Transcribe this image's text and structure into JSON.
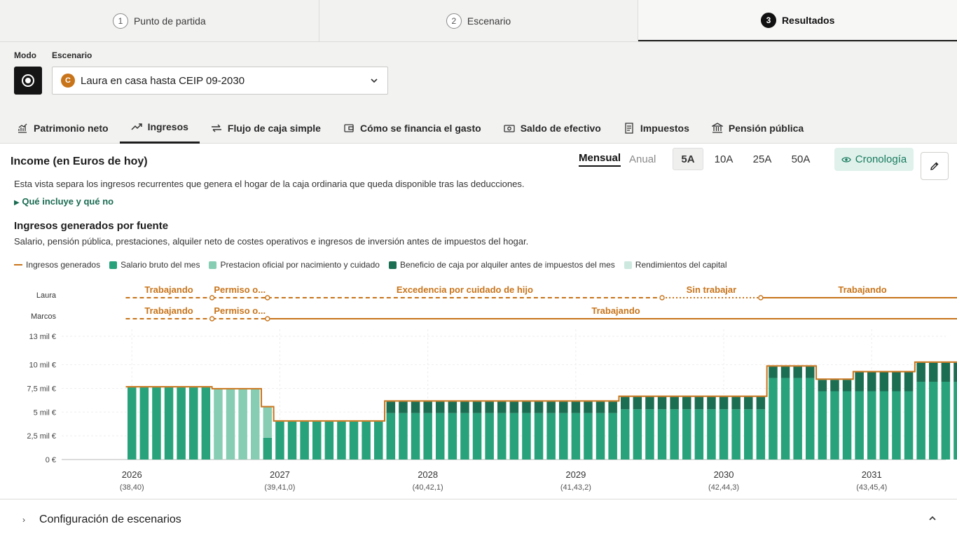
{
  "stepper": [
    {
      "num": "1",
      "label": "Punto de partida"
    },
    {
      "num": "2",
      "label": "Escenario"
    },
    {
      "num": "3",
      "label": "Resultados"
    }
  ],
  "scenario": {
    "mode_label": "Modo",
    "scenario_label": "Escenario",
    "badge": "C",
    "selected": "Laura en casa hasta CEIP 09-2030"
  },
  "tabs": [
    {
      "label": "Patrimonio neto",
      "icon": "chart-icon"
    },
    {
      "label": "Ingresos",
      "icon": "trend-up-icon"
    },
    {
      "label": "Flujo de caja simple",
      "icon": "swap-icon"
    },
    {
      "label": "Cómo se financia el gasto",
      "icon": "wallet-icon"
    },
    {
      "label": "Saldo de efectivo",
      "icon": "cash-icon"
    },
    {
      "label": "Impuestos",
      "icon": "receipt-icon"
    },
    {
      "label": "Pensión pública",
      "icon": "bank-icon"
    }
  ],
  "content": {
    "title": "Income (en Euros de hoy)",
    "mensual": "Mensual",
    "anual": "Anual",
    "ranges": [
      "5A",
      "10A",
      "25A",
      "50A"
    ],
    "cronologia": "Cronología",
    "desc": "Esta vista separa los ingresos recurrentes que genera el hogar de la caja ordinaria que queda disponible tras las deducciones.",
    "details": "Qué incluye y qué no",
    "h2": "Ingresos generados por fuente",
    "sub": "Salario, pensión pública, prestaciones, alquiler neto de costes operativos e ingresos de inversión antes de impuestos del hogar."
  },
  "colors": {
    "salario": "#27a27b",
    "prestacion": "#87cdb3",
    "alquiler": "#1b6e52",
    "rendimientos": "#cde9df",
    "ingresos_line": "#c8741a"
  },
  "chart_data": {
    "type": "bar",
    "stacked": true,
    "legend": [
      {
        "name": "Ingresos generados",
        "kind": "line"
      },
      {
        "name": "Salario bruto del mes",
        "kind": "salario"
      },
      {
        "name": "Prestacion oficial por nacimiento y cuidado",
        "kind": "prestacion"
      },
      {
        "name": "Beneficio de caja por alquiler antes de impuestos del mes",
        "kind": "alquiler"
      },
      {
        "name": "Rendimientos del capital",
        "kind": "rendimientos"
      }
    ],
    "y_ticks": [
      {
        "v": 0,
        "label": "0 €"
      },
      {
        "v": 2500,
        "label": "2,5 mil €"
      },
      {
        "v": 5000,
        "label": "5 mil €"
      },
      {
        "v": 7500,
        "label": "7,5 mil €"
      },
      {
        "v": 10000,
        "label": "10 mil €"
      },
      {
        "v": 13000,
        "label": "13 mil €"
      }
    ],
    "ylim": [
      0,
      13000
    ],
    "x_ticks": [
      {
        "month": 0,
        "year": "2026",
        "ages": "(38,40)"
      },
      {
        "month": 12,
        "year": "2027",
        "ages": "(39,41,0)"
      },
      {
        "month": 24,
        "year": "2028",
        "ages": "(40,42,1)"
      },
      {
        "month": 36,
        "year": "2029",
        "ages": "(41,43,2)"
      },
      {
        "month": 48,
        "year": "2030",
        "ages": "(42,44,3)"
      },
      {
        "month": 60,
        "year": "2031",
        "ages": "(43,45,4)"
      }
    ],
    "timeline": [
      {
        "person": "Laura",
        "segments": [
          {
            "label": "Trabajando",
            "start": -0.5,
            "end": 6.5,
            "style": "dashed"
          },
          {
            "label": "Permiso o...",
            "start": 6.5,
            "end": 11,
            "style": "dashed"
          },
          {
            "label": "Excedencia por cuidado de hijo",
            "start": 11,
            "end": 43,
            "style": "dashed"
          },
          {
            "label": "Sin trabajar",
            "start": 43,
            "end": 51,
            "style": "dotted"
          },
          {
            "label": "Trabajando",
            "start": 51,
            "end": 67.5,
            "style": "solid"
          }
        ]
      },
      {
        "person": "Marcos",
        "segments": [
          {
            "label": "Trabajando",
            "start": -0.5,
            "end": 6.5,
            "style": "dashed"
          },
          {
            "label": "Permiso o...",
            "start": 6.5,
            "end": 11,
            "style": "dashed"
          },
          {
            "label": "Trabajando",
            "start": 11,
            "end": 67.5,
            "style": "solid"
          }
        ]
      }
    ],
    "months": [
      {
        "s": 7600,
        "p": 0,
        "a": 0
      },
      {
        "s": 7600,
        "p": 0,
        "a": 0
      },
      {
        "s": 7600,
        "p": 0,
        "a": 0
      },
      {
        "s": 7600,
        "p": 0,
        "a": 0
      },
      {
        "s": 7600,
        "p": 0,
        "a": 0
      },
      {
        "s": 7600,
        "p": 0,
        "a": 0
      },
      {
        "s": 7600,
        "p": 0,
        "a": 0
      },
      {
        "s": 0,
        "p": 7400,
        "a": 0
      },
      {
        "s": 0,
        "p": 7400,
        "a": 0
      },
      {
        "s": 0,
        "p": 7400,
        "a": 0
      },
      {
        "s": 0,
        "p": 7400,
        "a": 0
      },
      {
        "s": 2300,
        "p": 3200,
        "a": 0
      },
      {
        "s": 4000,
        "p": 0,
        "a": 0
      },
      {
        "s": 4000,
        "p": 0,
        "a": 0
      },
      {
        "s": 4000,
        "p": 0,
        "a": 0
      },
      {
        "s": 4000,
        "p": 0,
        "a": 0
      },
      {
        "s": 4000,
        "p": 0,
        "a": 0
      },
      {
        "s": 4000,
        "p": 0,
        "a": 0
      },
      {
        "s": 4000,
        "p": 0,
        "a": 0
      },
      {
        "s": 4000,
        "p": 0,
        "a": 0
      },
      {
        "s": 4000,
        "p": 0,
        "a": 0
      },
      {
        "s": 4900,
        "p": 0,
        "a": 1200
      },
      {
        "s": 4900,
        "p": 0,
        "a": 1200
      },
      {
        "s": 4900,
        "p": 0,
        "a": 1200
      },
      {
        "s": 4900,
        "p": 0,
        "a": 1200
      },
      {
        "s": 4900,
        "p": 0,
        "a": 1200
      },
      {
        "s": 4900,
        "p": 0,
        "a": 1200
      },
      {
        "s": 4900,
        "p": 0,
        "a": 1200
      },
      {
        "s": 4900,
        "p": 0,
        "a": 1200
      },
      {
        "s": 4900,
        "p": 0,
        "a": 1200
      },
      {
        "s": 4900,
        "p": 0,
        "a": 1200
      },
      {
        "s": 4900,
        "p": 0,
        "a": 1200
      },
      {
        "s": 4900,
        "p": 0,
        "a": 1200
      },
      {
        "s": 4900,
        "p": 0,
        "a": 1200
      },
      {
        "s": 4900,
        "p": 0,
        "a": 1200
      },
      {
        "s": 4900,
        "p": 0,
        "a": 1200
      },
      {
        "s": 4900,
        "p": 0,
        "a": 1200
      },
      {
        "s": 4900,
        "p": 0,
        "a": 1200
      },
      {
        "s": 4900,
        "p": 0,
        "a": 1200
      },
      {
        "s": 4900,
        "p": 0,
        "a": 1200
      },
      {
        "s": 5300,
        "p": 0,
        "a": 1300
      },
      {
        "s": 5300,
        "p": 0,
        "a": 1300
      },
      {
        "s": 5300,
        "p": 0,
        "a": 1300
      },
      {
        "s": 5300,
        "p": 0,
        "a": 1300
      },
      {
        "s": 5300,
        "p": 0,
        "a": 1300
      },
      {
        "s": 5300,
        "p": 0,
        "a": 1300
      },
      {
        "s": 5300,
        "p": 0,
        "a": 1300
      },
      {
        "s": 5300,
        "p": 0,
        "a": 1300
      },
      {
        "s": 5300,
        "p": 0,
        "a": 1300
      },
      {
        "s": 5300,
        "p": 0,
        "a": 1300
      },
      {
        "s": 5300,
        "p": 0,
        "a": 1300
      },
      {
        "s": 5300,
        "p": 0,
        "a": 1300
      },
      {
        "s": 8600,
        "p": 0,
        "a": 1200
      },
      {
        "s": 8600,
        "p": 0,
        "a": 1200
      },
      {
        "s": 8600,
        "p": 0,
        "a": 1200
      },
      {
        "s": 8600,
        "p": 0,
        "a": 1200
      },
      {
        "s": 7200,
        "p": 0,
        "a": 1200
      },
      {
        "s": 7200,
        "p": 0,
        "a": 1200
      },
      {
        "s": 7200,
        "p": 0,
        "a": 1200
      },
      {
        "s": 7200,
        "p": 0,
        "a": 2000
      },
      {
        "s": 7200,
        "p": 0,
        "a": 2000
      },
      {
        "s": 7200,
        "p": 0,
        "a": 2000
      },
      {
        "s": 7200,
        "p": 0,
        "a": 2000
      },
      {
        "s": 7200,
        "p": 0,
        "a": 2000
      },
      {
        "s": 8200,
        "p": 0,
        "a": 2000
      },
      {
        "s": 8200,
        "p": 0,
        "a": 2000
      },
      {
        "s": 8200,
        "p": 0,
        "a": 2000
      },
      {
        "s": 8200,
        "p": 0,
        "a": 2000
      }
    ]
  },
  "footer": {
    "label": "Configuración de escenarios"
  }
}
